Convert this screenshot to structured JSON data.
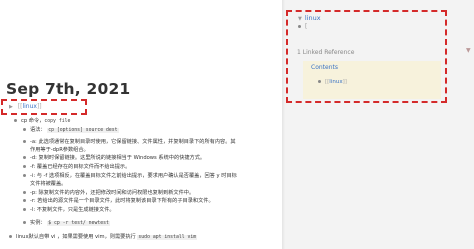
{
  "page": {
    "title": "Sep 7th, 2021"
  },
  "blocks": {
    "root_link": "linux",
    "cp_cmd": "cp 命令",
    "cp_sep": "，",
    "copy_file": "copy file",
    "syntax_label": "语法：",
    "syntax_code": "cp [options] source dest",
    "line_a": "-a: 此选项通常在复制目录时使用，它保留链接、文件属性，并复制目录下的所有内容。其",
    "line_a2": "作用等于-dpR参数组合。",
    "line_d": "-d: 复制时保留链接。这里所说的链接相当于 Windows 系统中的快捷方式。",
    "line_f": "-f: 覆盖已经存在的目标文件而不给出提示。",
    "line_i": "-i: 与 -f 选项相反，在覆盖目标文件之前给出提示，要求用户确认是否覆盖，回答 y 时目标",
    "line_i2": "文件将被覆盖。",
    "line_p": "-p: 除复制文件的内容外，还把修改时间和访问权限也复制到新文件中。",
    "line_r": "-r: 若给出的源文件是一个目录文件，此时将复制该目录下所有的子目录和文件。",
    "line_l": "-l: 不复制文件，只是生成链接文件。",
    "example_label": "实例：",
    "example_code": "$ cp -r test/ newtest",
    "bottom_text": "linux默认自带 vi ，如果需要使用 vim，则需要执行",
    "bottom_code": "sudo apt install vim"
  },
  "sidebar": {
    "page_link": "linux",
    "cursor": "[",
    "section_title": "1 Linked Reference",
    "contents_title": "Contents",
    "contents_item": "linux"
  },
  "colors": {
    "link": "#3a73c4",
    "highlight_border": "#d42a2a",
    "contents_bg": "#f7f2dc",
    "sidebar_bg": "#f3f3f3"
  }
}
